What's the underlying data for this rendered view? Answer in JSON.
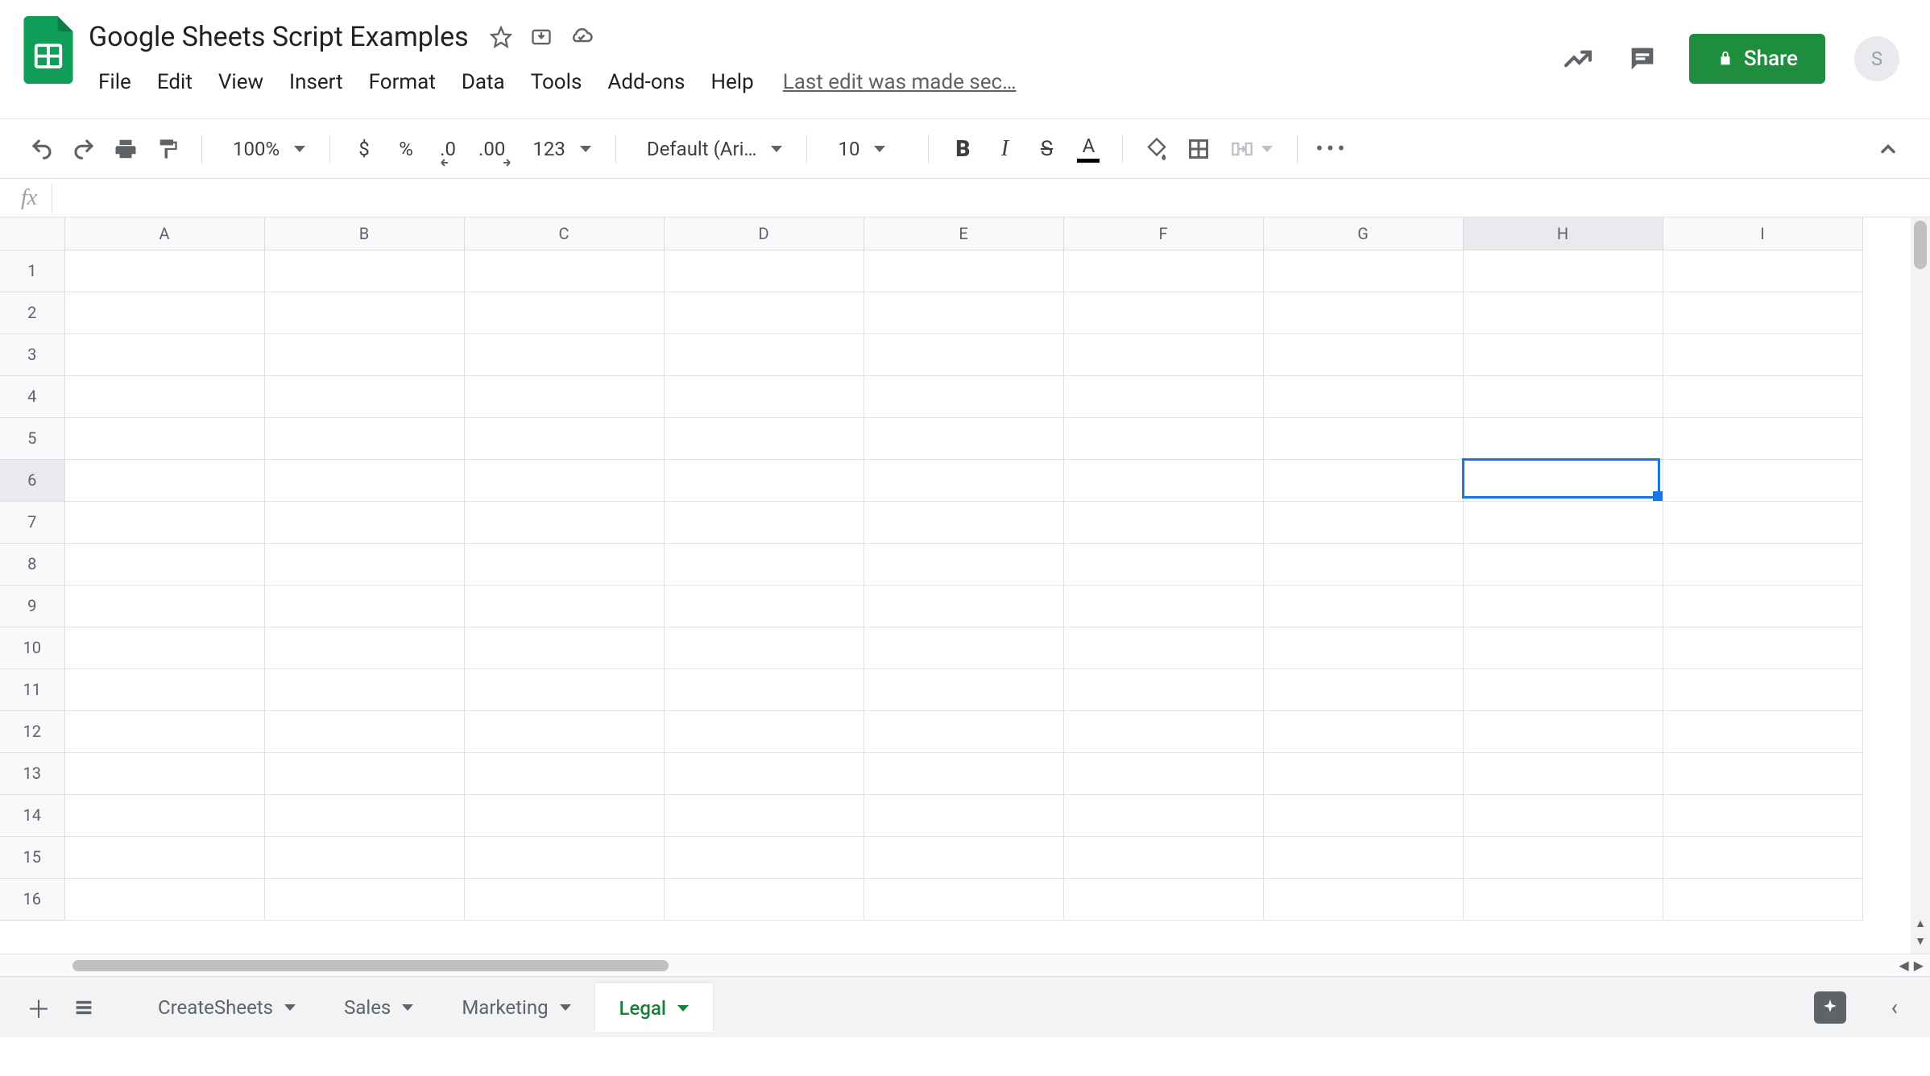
{
  "doc": {
    "title": "Google Sheets Script Examples",
    "last_edit": "Last edit was made sec…"
  },
  "menus": {
    "file": "File",
    "edit": "Edit",
    "view": "View",
    "insert": "Insert",
    "format": "Format",
    "data": "Data",
    "tools": "Tools",
    "addons": "Add-ons",
    "help": "Help"
  },
  "header": {
    "share_label": "Share",
    "avatar_initial": "S"
  },
  "toolbar": {
    "zoom": "100%",
    "currency": "$",
    "percent": "%",
    "dec_decrease": ".0",
    "dec_increase": ".00",
    "format_more": "123",
    "font": "Default (Ari…",
    "font_size": "10"
  },
  "formula_bar": {
    "fx": "fx",
    "value": ""
  },
  "grid": {
    "columns": [
      "A",
      "B",
      "C",
      "D",
      "E",
      "F",
      "G",
      "H",
      "I"
    ],
    "rows": [
      "1",
      "2",
      "3",
      "4",
      "5",
      "6",
      "7",
      "8",
      "9",
      "10",
      "11",
      "12",
      "13",
      "14",
      "15",
      "16"
    ],
    "selected_col": "H",
    "selected_row": "6",
    "selected_col_idx": 7,
    "selected_row_idx": 5
  },
  "sheets": {
    "tabs": [
      {
        "label": "CreateSheets",
        "active": false
      },
      {
        "label": "Sales",
        "active": false
      },
      {
        "label": "Marketing",
        "active": false
      },
      {
        "label": "Legal",
        "active": true
      }
    ]
  }
}
